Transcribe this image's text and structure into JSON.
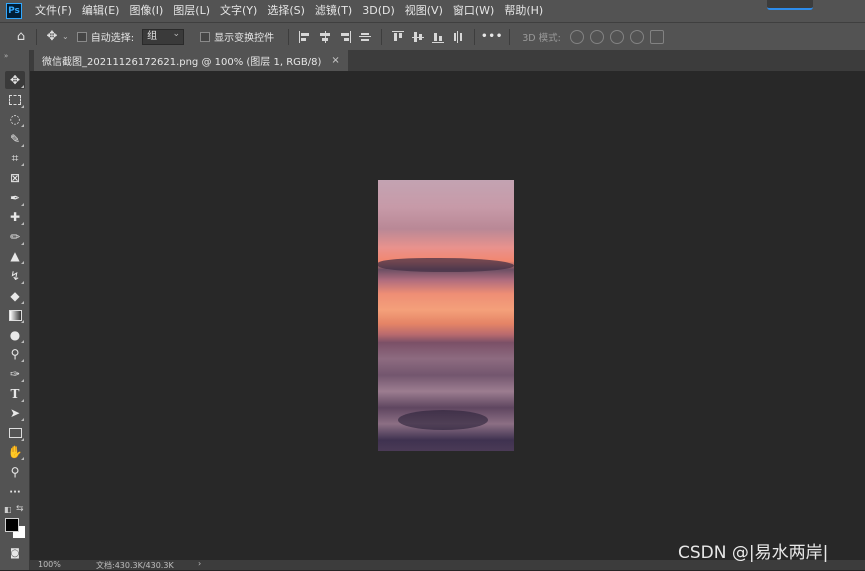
{
  "app": {
    "logo": "Ps"
  },
  "menu": [
    {
      "label": "文件(F)"
    },
    {
      "label": "编辑(E)"
    },
    {
      "label": "图像(I)"
    },
    {
      "label": "图层(L)"
    },
    {
      "label": "文字(Y)"
    },
    {
      "label": "选择(S)"
    },
    {
      "label": "滤镜(T)"
    },
    {
      "label": "3D(D)"
    },
    {
      "label": "视图(V)"
    },
    {
      "label": "窗口(W)"
    },
    {
      "label": "帮助(H)"
    }
  ],
  "options_bar": {
    "auto_select_label": "自动选择:",
    "auto_select_value": "组",
    "show_transform_label": "显示变换控件",
    "more_label": "•••",
    "mode_3d_label": "3D 模式:"
  },
  "document": {
    "tab_title": "微信截图_20211126172621.png @ 100% (图层 1, RGB/8)",
    "close": "×"
  },
  "status": {
    "zoom": "100%",
    "doc_size": "文档:430.3K/430.3K",
    "arrow": "›"
  },
  "watermark": "CSDN @|易水两岸|",
  "colors": {
    "foreground": "#000000",
    "background": "#ffffff",
    "accent": "#31a8ff"
  }
}
